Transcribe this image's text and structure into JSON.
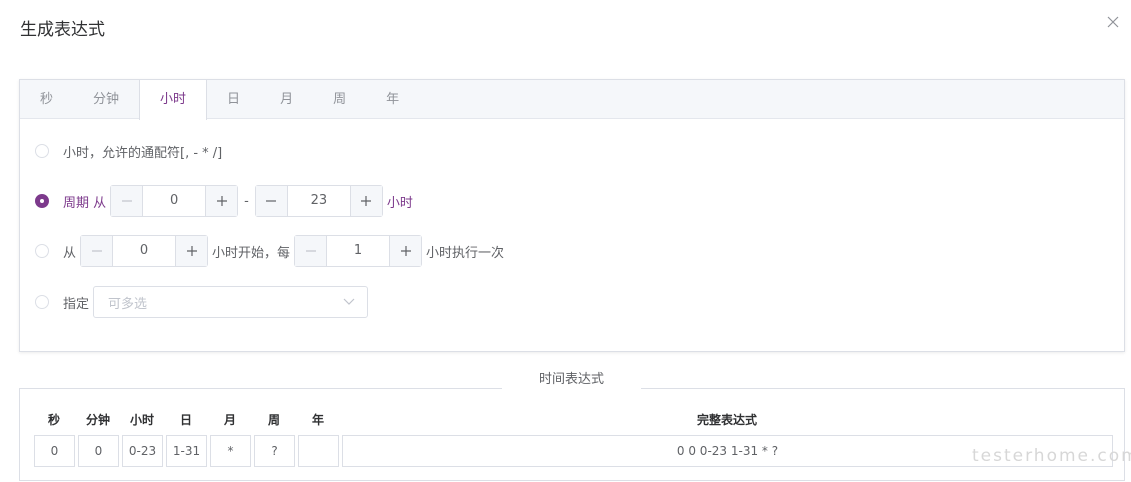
{
  "dialog": {
    "title": "生成表达式"
  },
  "tabs": [
    {
      "label": "秒"
    },
    {
      "label": "分钟"
    },
    {
      "label": "小时"
    },
    {
      "label": "日"
    },
    {
      "label": "月"
    },
    {
      "label": "周"
    },
    {
      "label": "年"
    }
  ],
  "options": {
    "wildcard": {
      "label": "小时，允许的通配符[, - * /]"
    },
    "period": {
      "label": "周期 从",
      "from": "0",
      "to": "23",
      "dash": "-",
      "suffix": "小时"
    },
    "interval": {
      "label": "从",
      "start": "0",
      "middle": "小时开始，每",
      "every": "1",
      "suffix": "小时执行一次"
    },
    "specify": {
      "label": "指定",
      "placeholder": "可多选"
    }
  },
  "expression": {
    "legend": "时间表达式",
    "headers": [
      "秒",
      "分钟",
      "小时",
      "日",
      "月",
      "周",
      "年",
      "完整表达式"
    ],
    "values": [
      "0",
      "0",
      "0-23",
      "1-31",
      "*",
      "?",
      "",
      "0 0 0-23 1-31 * ?"
    ]
  },
  "watermark": "testerhome.com",
  "colors": {
    "accent": "#7d3a8c",
    "border": "#dcdfe6"
  },
  "icons": {
    "close": "close-icon",
    "select": "chevron-down-icon",
    "minus": "minus-icon",
    "plus": "plus-icon"
  }
}
